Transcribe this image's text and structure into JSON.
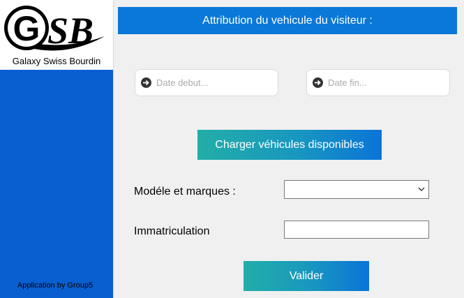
{
  "sidebar": {
    "logo_caption": "Galaxy Swiss Bourdin",
    "footer_credit": "Application by Group5",
    "color": "#0a5fd0"
  },
  "header": {
    "title": "Attribution du vehicule du visiteur :",
    "color": "#0a78d8"
  },
  "dates": {
    "start_placeholder": "Date debut...",
    "end_placeholder": "Date fin..."
  },
  "buttons": {
    "load_label": "Charger véhicules disponibles",
    "submit_label": "Valider"
  },
  "form": {
    "model_label": "Modéle et marques :",
    "model_value": "",
    "plate_label": "Immatriculation",
    "plate_value": ""
  },
  "icons": {
    "date_start": "arrow-circle-right-icon",
    "date_end": "arrow-circle-right-icon",
    "dropdown": "chevron-down-icon"
  }
}
